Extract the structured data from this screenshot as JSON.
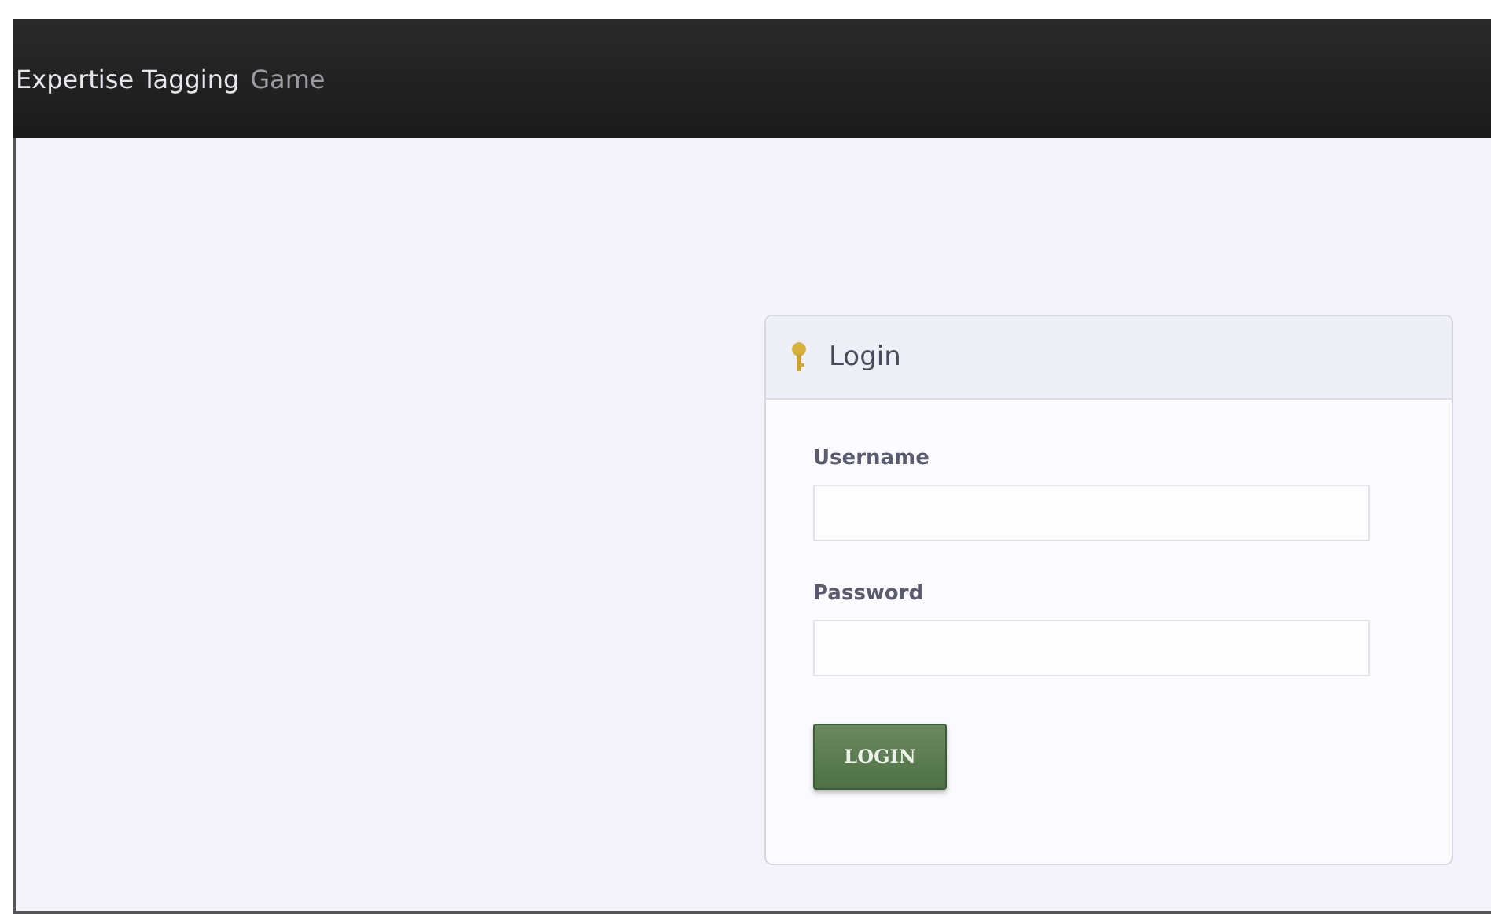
{
  "header": {
    "title": "Expertise Tagging",
    "subtitle": "Game"
  },
  "login_panel": {
    "title": "Login",
    "fields": [
      {
        "label": "Username"
      },
      {
        "label": "Password"
      }
    ],
    "button": "LOGIN"
  }
}
